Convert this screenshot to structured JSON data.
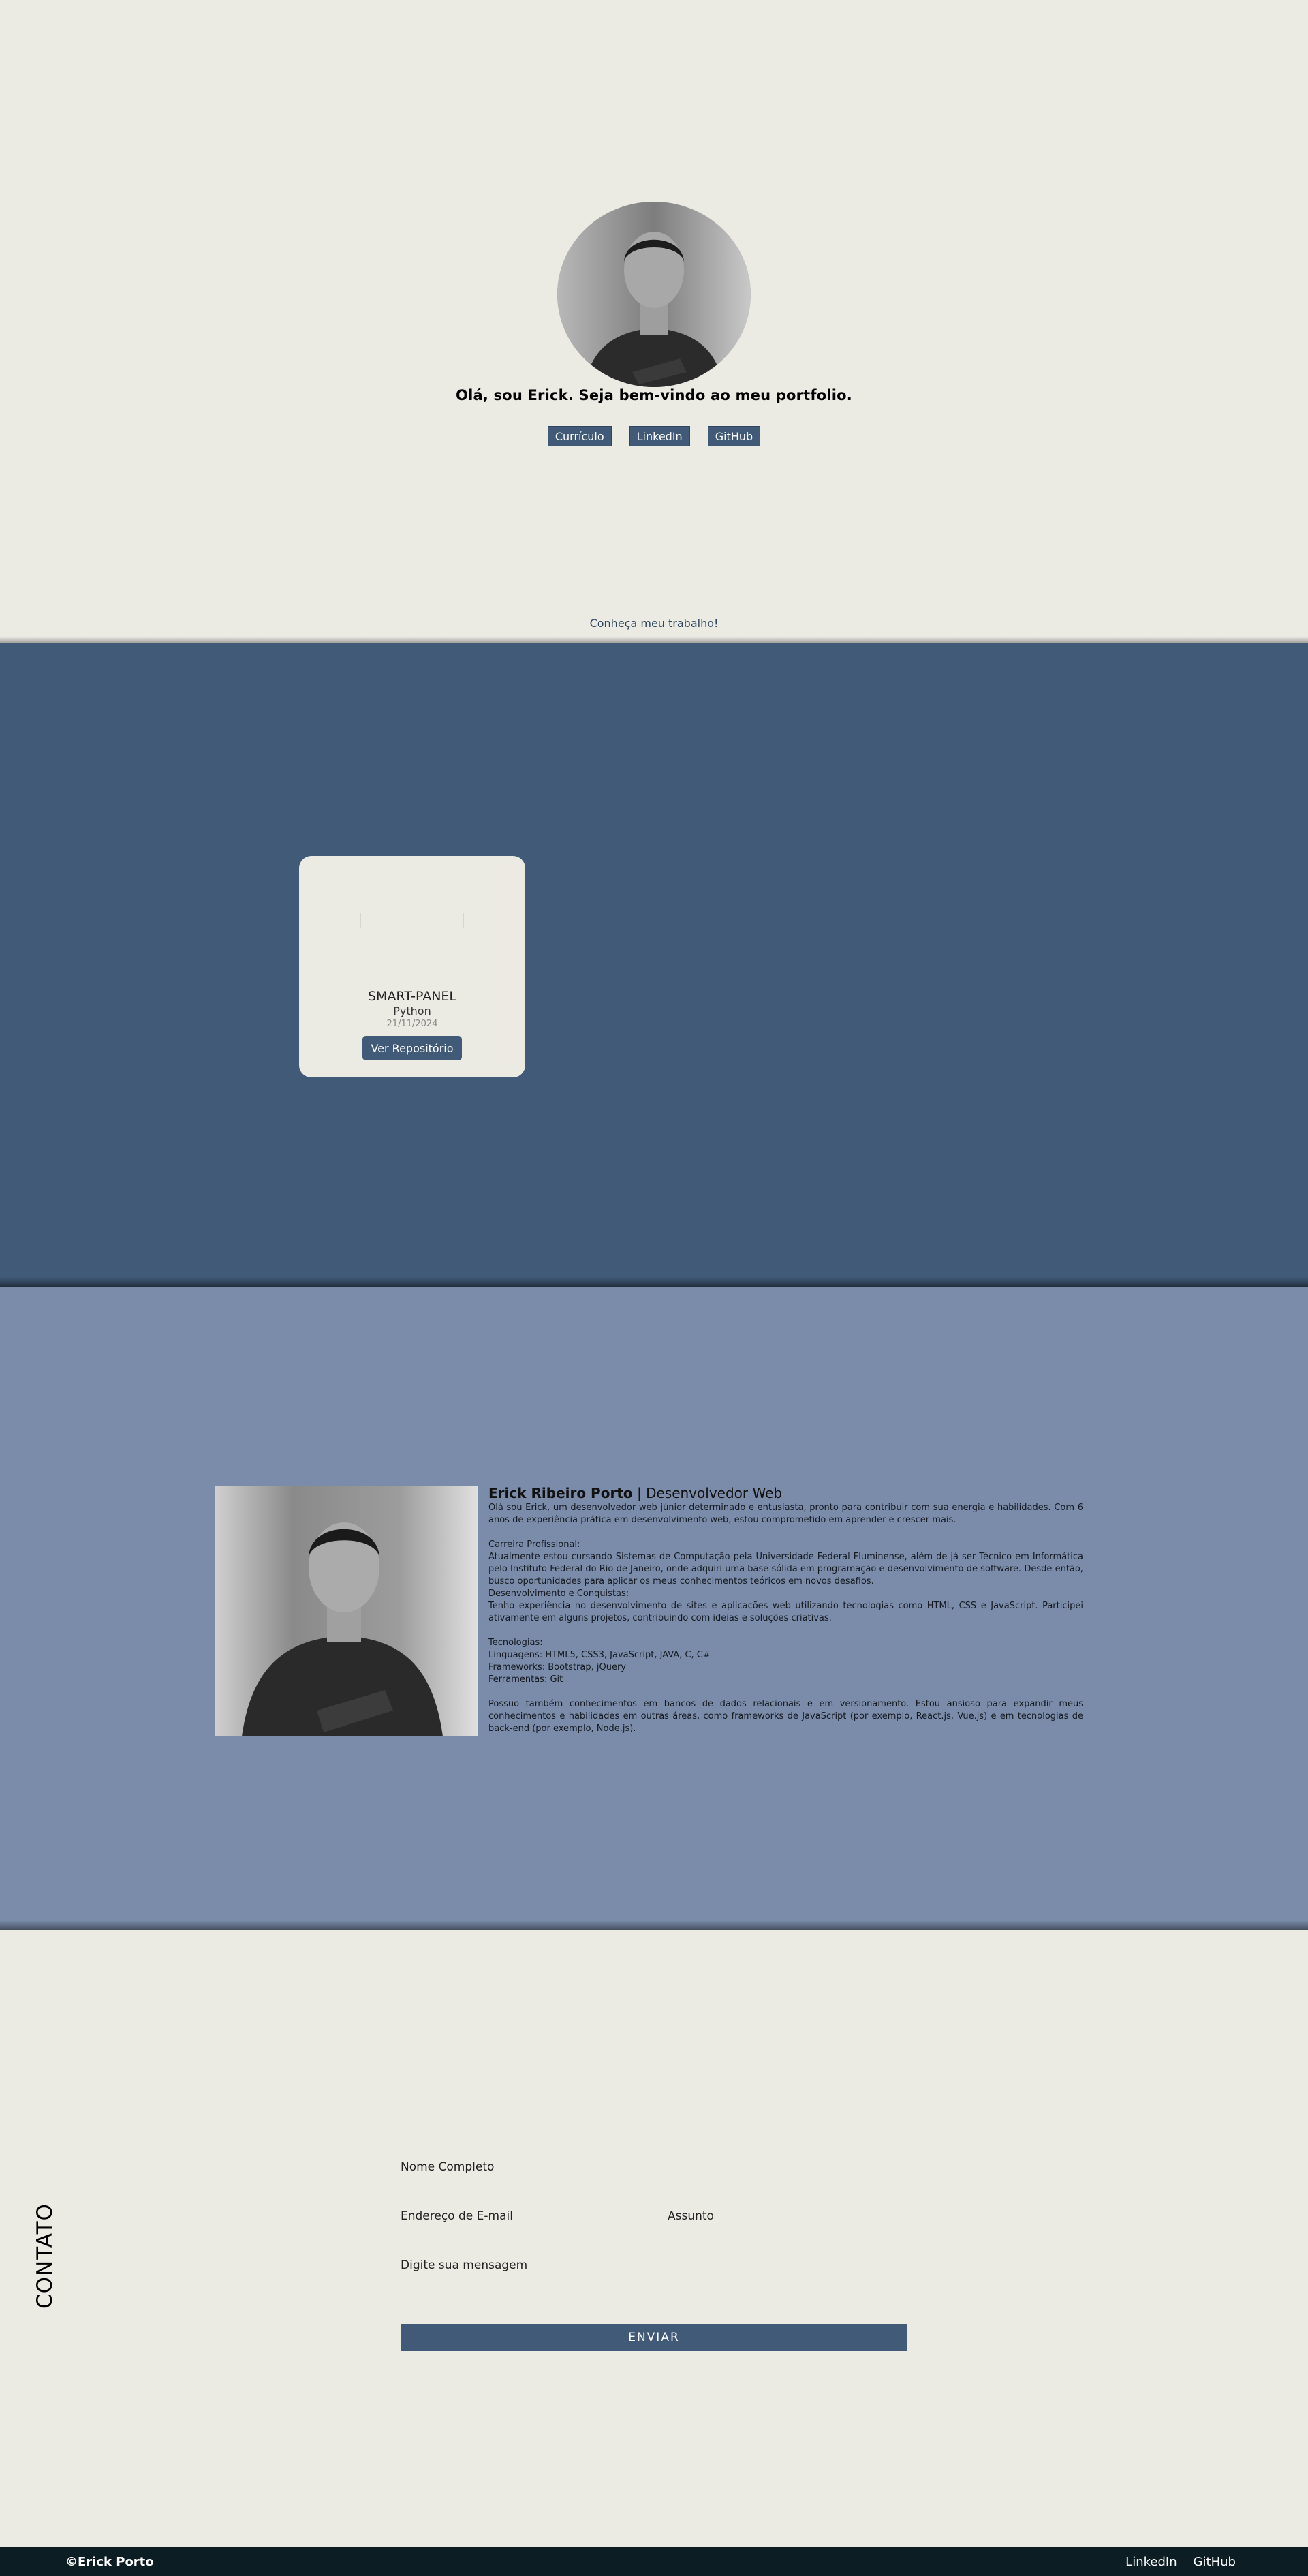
{
  "hero": {
    "title": "Olá, sou Erick. Seja bem-vindo ao meu portfolio.",
    "buttons": [
      "Currículo",
      "LinkedIn",
      "GitHub"
    ],
    "cta_link": "Conheça meu trabalho!"
  },
  "projects": {
    "cards": [
      {
        "title": "SMART-PANEL",
        "language": "Python",
        "date": "21/11/2024",
        "button": "Ver Repositório"
      }
    ]
  },
  "about": {
    "name": "Erick Ribeiro Porto",
    "role": " | Desenvolvedor Web",
    "paragraphs": [
      "Olá sou Erick, um desenvolvedor web júnior determinado e entusiasta, pronto para contribuir com sua energia e habilidades. Com 6 anos de experiência prática em desenvolvimento web, estou comprometido em aprender e crescer mais.",
      "",
      "Carreira Profissional:",
      "Atualmente estou cursando Sistemas de Computação pela Universidade Federal Fluminense, além de já ser Técnico em Informática pelo Instituto Federal do Rio de Janeiro, onde adquiri uma base sólida em programação e desenvolvimento de software. Desde então, busco oportunidades para aplicar os meus conhecimentos teóricos em novos desafios.",
      "Desenvolvimento e Conquistas:",
      "Tenho experiência no desenvolvimento de sites e aplicações web utilizando tecnologias como HTML, CSS e JavaScript. Participei ativamente em alguns projetos, contribuindo com ideias e soluções criativas.",
      "",
      "Tecnologias:",
      "Linguagens: HTML5, CSS3, JavaScript, JAVA, C, C#",
      "Frameworks: Bootstrap, jQuery",
      "Ferramentas: Git",
      "",
      "Possuo também conhecimentos em bancos de dados relacionais e em versionamento. Estou ansioso para expandir meus conhecimentos e habilidades em outras áreas, como frameworks de JavaScript (por exemplo, React.js, Vue.js) e em tecnologias de back-end (por exemplo, Node.js)."
    ]
  },
  "contact": {
    "heading": "CONTATO",
    "name_placeholder": "Nome Completo",
    "email_placeholder": "Endereço de E-mail",
    "subject_placeholder": "Assunto",
    "message_placeholder": "Digite sua mensagem",
    "send": "ENVIAR"
  },
  "footer": {
    "copyright": "©Erick Porto",
    "links": [
      "LinkedIn",
      "GitHub"
    ]
  },
  "colors": {
    "background": "#ebeae3",
    "primary": "#415a78",
    "about_bg": "#7a8ca9",
    "footer_bg": "#0d1d24"
  }
}
